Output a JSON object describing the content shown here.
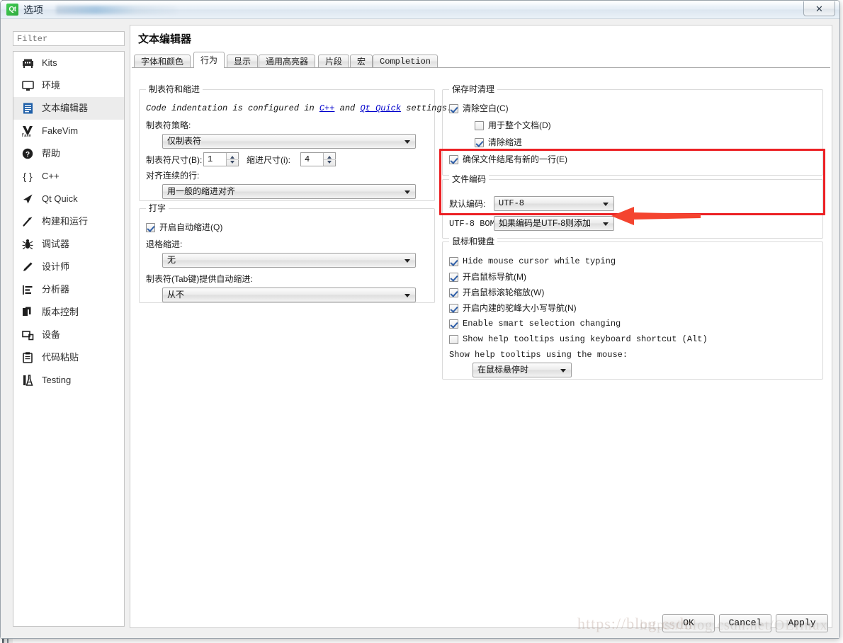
{
  "window": {
    "title": "选项",
    "logo_text": "Qt",
    "close_label": "✕"
  },
  "sidebar": {
    "filter_placeholder": "Filter",
    "filter_value": "",
    "items": [
      {
        "label": "Kits",
        "icon": "kits-icon",
        "selected": false
      },
      {
        "label": "环境",
        "icon": "monitor-icon",
        "selected": false
      },
      {
        "label": "文本编辑器",
        "icon": "text-editor-icon",
        "selected": true
      },
      {
        "label": "FakeVim",
        "icon": "fakevim-icon",
        "selected": false
      },
      {
        "label": "帮助",
        "icon": "help-icon",
        "selected": false
      },
      {
        "label": "C++",
        "icon": "braces-icon",
        "selected": false
      },
      {
        "label": "Qt Quick",
        "icon": "qtquick-icon",
        "selected": false
      },
      {
        "label": "构建和运行",
        "icon": "hammer-icon",
        "selected": false
      },
      {
        "label": "调试器",
        "icon": "bug-icon",
        "selected": false
      },
      {
        "label": "设计师",
        "icon": "pencil-icon",
        "selected": false
      },
      {
        "label": "分析器",
        "icon": "analyzer-icon",
        "selected": false
      },
      {
        "label": "版本控制",
        "icon": "version-control-icon",
        "selected": false
      },
      {
        "label": "设备",
        "icon": "devices-icon",
        "selected": false
      },
      {
        "label": "代码粘贴",
        "icon": "clipboard-icon",
        "selected": false
      },
      {
        "label": "Testing",
        "icon": "flask-icon",
        "selected": false
      }
    ]
  },
  "pane": {
    "title": "文本编辑器",
    "tabs": [
      {
        "label": "字体和颜色",
        "active": false,
        "mono": false
      },
      {
        "label": "行为",
        "active": true,
        "mono": false
      },
      {
        "label": "显示",
        "active": false,
        "mono": false
      },
      {
        "label": "通用高亮器",
        "active": false,
        "mono": false
      },
      {
        "label": "片段",
        "active": false,
        "mono": false
      },
      {
        "label": "宏",
        "active": false,
        "mono": false
      },
      {
        "label": "Completion",
        "active": false,
        "mono": true
      }
    ]
  },
  "tabs_indent": {
    "group_title": "制表符和缩进",
    "note_prefix": "Code indentation is configured in ",
    "note_link1": "C++",
    "note_mid": " and ",
    "note_link2": "Qt Quick",
    "note_suffix": " settings.",
    "tab_policy_label": "制表符策略:",
    "tab_policy_value": "仅制表符",
    "tab_size_label": "制表符尺寸(B):",
    "tab_size_value": "1",
    "indent_size_label": "缩进尺寸(i):",
    "indent_size_value": "4",
    "align_label": "对齐连续的行:",
    "align_value": "用一般的缩进对齐"
  },
  "typing": {
    "group_title": "打字",
    "auto_indent_label": "开启自动缩进(Q)",
    "auto_indent_checked": true,
    "backspace_label": "退格缩进:",
    "backspace_value": "无",
    "tab_key_label": "制表符(Tab键)提供自动缩进:",
    "tab_key_value": "从不"
  },
  "cleanup": {
    "group_title": "保存时清理",
    "clean_whitespace_label": "清除空白(C)",
    "clean_whitespace_checked": true,
    "whole_doc_label": "用于整个文档(D)",
    "whole_doc_checked": false,
    "clean_indent_label": "清除缩进",
    "clean_indent_checked": true,
    "ensure_newline_label": "确保文件结尾有新的一行(E)",
    "ensure_newline_checked": true
  },
  "file_encoding": {
    "group_title": "文件编码",
    "default_label": "默认编码:",
    "default_value": "UTF-8",
    "bom_label": "UTF-8 BOM:",
    "bom_value": "如果编码是UTF-8则添加",
    "highlight_color": "#ec2024",
    "arrow_color": "#f4442f"
  },
  "mouse_keyboard": {
    "group_title": "鼠标和键盘",
    "hide_cursor_label": "Hide mouse cursor while typing",
    "hide_cursor_checked": true,
    "mouse_nav_label": "开启鼠标导航(M)",
    "mouse_nav_checked": true,
    "wheel_zoom_label": "开启鼠标滚轮缩放(W)",
    "wheel_zoom_checked": true,
    "camel_case_label": "开启内建的驼峰大小写导航(N)",
    "camel_case_checked": true,
    "smart_selection_label": "Enable smart selection changing",
    "smart_selection_checked": true,
    "tooltip_shortcut_label": "Show help tooltips using keyboard shortcut (Alt)",
    "tooltip_shortcut_checked": false,
    "tooltip_mouse_label": "Show help tooltips using the mouse:",
    "tooltip_mouse_value": "在鼠标悬停时"
  },
  "footer": {
    "ok_label": "OK",
    "cancel_label": "Cancel",
    "apply_label": "Apply",
    "watermark": "https://blog.csdn",
    "watermark2": "https://blog.csdn.net/OEIinux"
  }
}
